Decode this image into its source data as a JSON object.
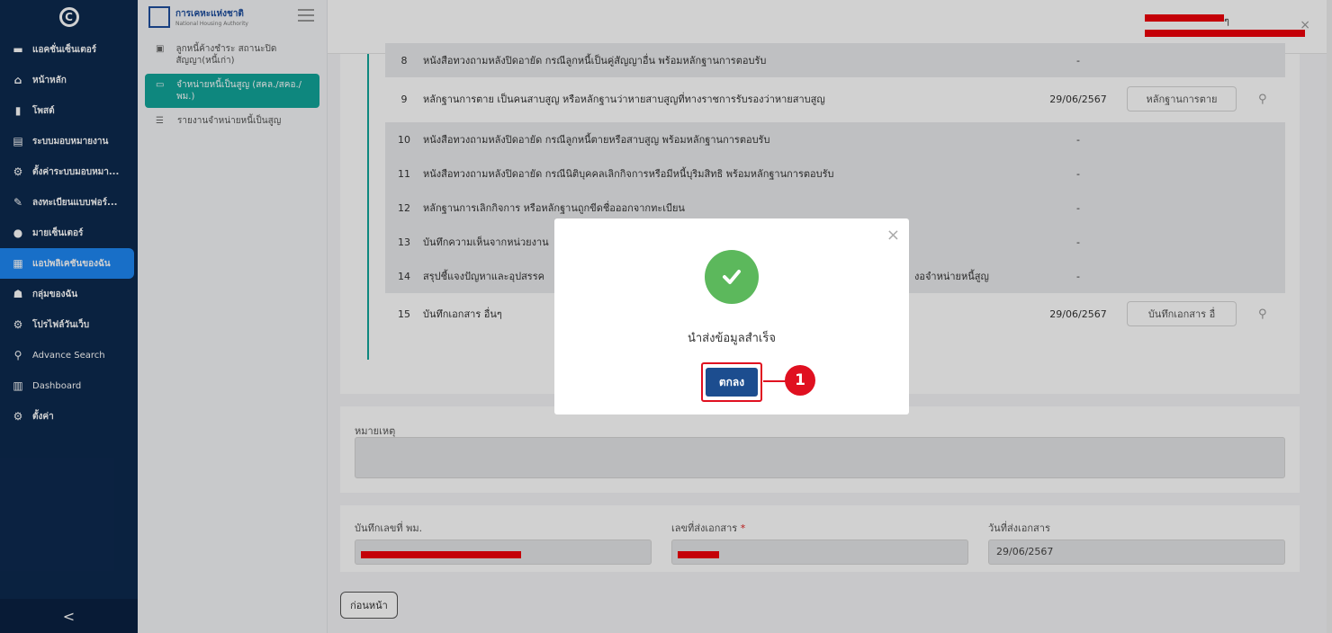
{
  "sidebar": {
    "items": [
      {
        "label": "แอคชั่นเซ็นเตอร์",
        "icon": "inbox-icon"
      },
      {
        "label": "หน้าหลัก",
        "icon": "home-icon"
      },
      {
        "label": "โพสต์",
        "icon": "post-icon"
      },
      {
        "label": "ระบบมอบหมายงาน",
        "icon": "document-icon"
      },
      {
        "label": "ตั้งค่าระบบมอบหมา...",
        "icon": "gear-icon"
      },
      {
        "label": "ลงทะเบียนแบบฟอร์...",
        "icon": "form-icon"
      },
      {
        "label": "มายเซ็นเตอร์",
        "icon": "user-icon"
      },
      {
        "label": "แอปพลิเคชันของฉัน",
        "icon": "apps-icon"
      },
      {
        "label": "กลุ่มของฉัน",
        "icon": "group-icon"
      },
      {
        "label": "โปรไฟล์วันเว็บ",
        "icon": "profile-gear-icon"
      },
      {
        "label": "Advance Search",
        "icon": "search-icon"
      },
      {
        "label": "Dashboard",
        "icon": "chart-icon"
      },
      {
        "label": "ตั้งค่า",
        "icon": "settings-icon"
      }
    ],
    "collapse": "<"
  },
  "brand": {
    "title": "การเคหะแห่งชาติ",
    "subtitle": "National Housing Authority"
  },
  "submenu": [
    {
      "label": "ลูกหนี้ค้างชำระ สถานะปิดสัญญา(หนี้เก่า)"
    },
    {
      "label": "จำหน่ายหนี้เป็นสูญ (สคล./สคอ./พม.)"
    },
    {
      "label": "รายงานจำหน่ายหนี้เป็นสูญ"
    }
  ],
  "rows": [
    {
      "num": "8",
      "text": "หนังสือทวงถามหลังปิดอายัด กรณีลูกหนี้เป็นคู่สัญญาอื่น พร้อมหลักฐานการตอบรับ",
      "date": "-",
      "file": ""
    },
    {
      "num": "9",
      "text": "หลักฐานการตาย เป็นคนสาบสูญ หรือหลักฐานว่าหายสาบสูญที่ทางราชการรับรองว่าหายสาบสูญ",
      "date": "29/06/2567",
      "file": "หลักฐานการตาย"
    },
    {
      "num": "10",
      "text": "หนังสือทวงถามหลังปิดอายัด กรณีลูกหนี้ตายหรือสาบสูญ พร้อมหลักฐานการตอบรับ",
      "date": "-",
      "file": ""
    },
    {
      "num": "11",
      "text": "หนังสือทวงถามหลังปิดอายัด กรณีนิติบุคคลเลิกกิจการหรือมีหนี้บุริมสิทธิ พร้อมหลักฐานการตอบรับ",
      "date": "-",
      "file": ""
    },
    {
      "num": "12",
      "text": "หลักฐานการเลิกกิจการ หรือหลักฐานถูกขีดชื่อออกจากทะเบียน",
      "date": "-",
      "file": ""
    },
    {
      "num": "13",
      "text": "บันทึกความเห็นจากหน่วยงาน",
      "date": "-",
      "file": ""
    },
    {
      "num": "14",
      "text": "สรุปชี้แจงปัญหาและอุปสรรค",
      "text_right": "งอจำหน่ายหนี้สูญ",
      "date": "-",
      "file": ""
    },
    {
      "num": "15",
      "text": "บันทึกเอกสาร อื่นๆ",
      "date": "29/06/2567",
      "file": "บันทึกเอกสาร อื่"
    }
  ],
  "note": {
    "label": "หมายเหตุ"
  },
  "doc": {
    "memo_label": "บันทึกเลขที่ พม.",
    "doc_no_label": "เลขที่ส่งเอกสาร",
    "required_mark": "*",
    "date_label": "วันที่ส่งเอกสาร",
    "date_value": "29/06/2567"
  },
  "back_label": "ก่อนหน้า",
  "modal": {
    "message": "นำส่งข้อมูลสำเร็จ",
    "ok": "ตกลง",
    "close": "×"
  },
  "callout": "1",
  "header": {
    "user_suffix": "ๆ"
  }
}
